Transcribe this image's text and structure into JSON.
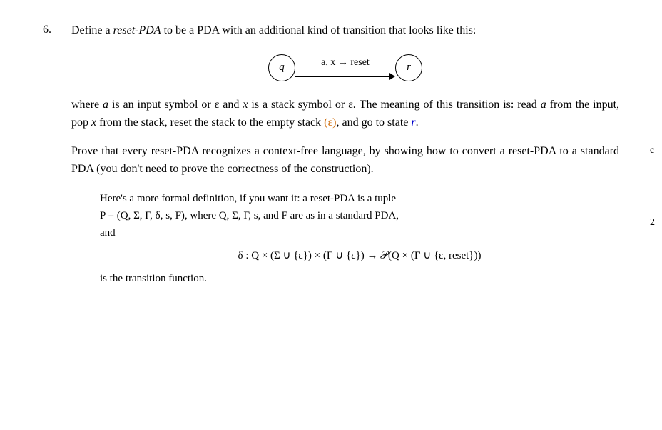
{
  "page": {
    "problem_number": "6.",
    "intro_text_1": "Define a ",
    "reset_pda_term": "reset-PDA",
    "intro_text_2": " to be a PDA with an additional kind of transition that looks like this:",
    "diagram": {
      "state_q": "q",
      "state_r": "r",
      "arrow_label": "a, x → reset"
    },
    "where_text": "where ",
    "a_var": "a",
    "where_text2": " is an input symbol or ε and ",
    "x_var": "x",
    "where_text3": " is a stack symbol or ε. The meaning of this transition is: read ",
    "a_var2": "a",
    "where_text4": " from the input, pop ",
    "x_var2": "x",
    "where_text5": " from the stack, reset the stack to the empty stack ",
    "epsilon_orange": "(ε)",
    "where_text6": ", and go to state ",
    "r_blue": "r",
    "where_text7": ".",
    "prove_text": "Prove that every reset-PDA recognizes a context-free language, by showing how to convert a reset-PDA to a standard PDA (you don't need to prove the correctness of the construction).",
    "indented_block": {
      "line1a": "Here's a more formal definition, if you want it: a reset-PDA is a tuple",
      "line1b": "P = (Q, Σ, Γ, δ, s, F), where Q, Σ, Γ, s, and F are as in a standard PDA,",
      "line2": "and",
      "delta_display": "δ : Q × (Σ ∪ {ε}) × (Γ ∪ {ε}) → 𝒫(Q × (Γ ∪ {ε, reset}))",
      "line3": "is the transition function."
    },
    "side_numbers": [
      "c",
      "2"
    ]
  }
}
